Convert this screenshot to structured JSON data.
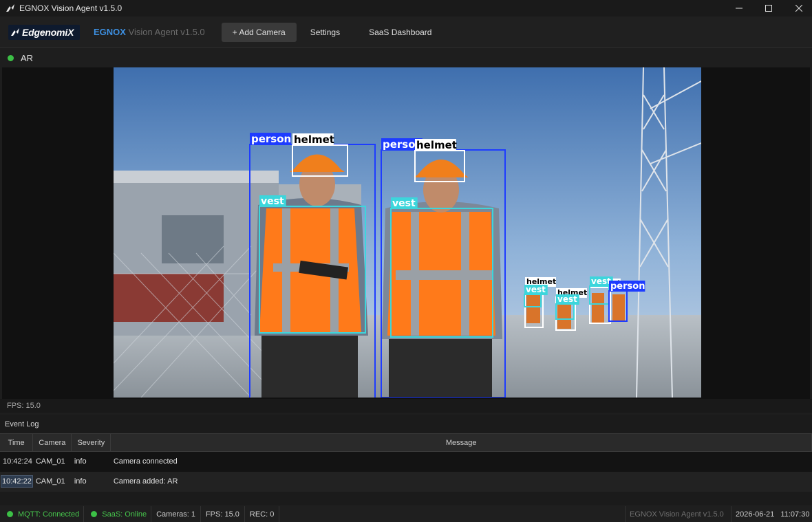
{
  "window": {
    "title": "EGNOX Vision Agent  v1.5.0"
  },
  "toolbar": {
    "logo_text": "EdgenomiX",
    "brand_primary": "EGNOX",
    "brand_secondary": "Vision Agent v1.5.0",
    "add_camera_label": "+ Add Camera",
    "settings_label": "Settings",
    "saas_dashboard_label": "SaaS Dashboard"
  },
  "camera": {
    "name": "AR",
    "status_color": "#3cc046",
    "fps_text": "FPS: 15.0",
    "detections": [
      {
        "label": "person",
        "color": "#1e3cff"
      },
      {
        "label": "helmet",
        "color": "#ffffff"
      },
      {
        "label": "person",
        "color": "#1e3cff"
      },
      {
        "label": "helmet",
        "color": "#ffffff"
      },
      {
        "label": "vest",
        "color": "#3cd6dc"
      },
      {
        "label": "vest",
        "color": "#3cd6dc"
      },
      {
        "label": "helmet",
        "color": "#ffffff"
      },
      {
        "label": "vest",
        "color": "#3cd6dc"
      },
      {
        "label": "helmet",
        "color": "#ffffff"
      },
      {
        "label": "vest",
        "color": "#3cd6dc"
      },
      {
        "label": "helmet",
        "color": "#ffffff"
      },
      {
        "label": "vest",
        "color": "#3cd6dc"
      },
      {
        "label": "person",
        "color": "#1e3cff"
      }
    ]
  },
  "event_log": {
    "title": "Event Log",
    "columns": [
      "Time",
      "Camera",
      "Severity",
      "Message"
    ],
    "rows": [
      {
        "time": "10:42:24",
        "camera": "CAM_01",
        "severity": "info",
        "message": "Camera connected"
      },
      {
        "time": "10:42:22",
        "camera": "CAM_01",
        "severity": "info",
        "message": "Camera added: AR"
      }
    ]
  },
  "statusbar": {
    "mqtt": "MQTT: Connected",
    "saas": "SaaS: Online",
    "cameras": "Cameras: 1",
    "fps": "FPS: 15.0",
    "rec": "REC: 0",
    "app_version": "EGNOX Vision Agent  v1.5.0",
    "datetime": "2026-06-21   11:07:30"
  },
  "colors": {
    "accent": "#3d8fe0",
    "status_ok": "#3cc046"
  }
}
